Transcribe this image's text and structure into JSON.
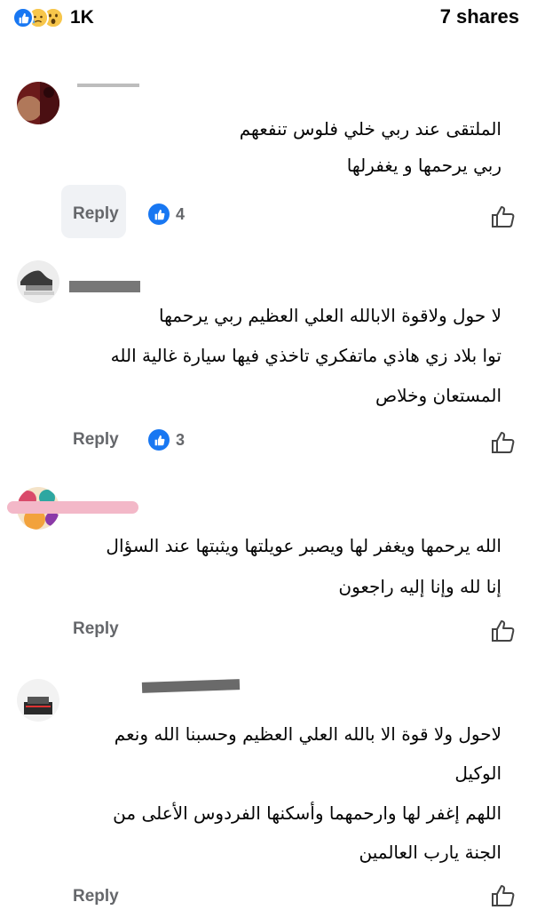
{
  "reactions_bar": {
    "icons": [
      "like-icon",
      "sad-icon",
      "wow-icon"
    ],
    "count": "1K",
    "shares": "7 shares"
  },
  "colors": {
    "like_blue": "#1877f2",
    "reply_gray": "#65676b",
    "text": "#050505"
  },
  "comments": [
    {
      "lines": [
        "الملتقى عند ربي خلي فلوس تنفعهم",
        "ربي يرحمها و يغفرلها"
      ],
      "reply_label": "Reply",
      "like_count": "4"
    },
    {
      "lines": [
        "لا حول ولاقوة الابالله العلي العظيم ربي يرحمها",
        "توا بلاد زي هاذي ماتفكري تاخذي فيها سيارة غالية الله",
        "المستعان وخلاص"
      ],
      "reply_label": "Reply",
      "like_count": "3"
    },
    {
      "lines": [
        "الله يرحمها ويغفر لها ويصبر عويلتها ويثبتها عند السؤال",
        "إنا لله وإنا إليه راجعون"
      ],
      "reply_label": "Reply"
    },
    {
      "lines": [
        "لاحول ولا قوة الا بالله العلي العظيم وحسبنا الله ونعم",
        "الوكيل",
        "اللهم إغفر لها وارحمهما وأسكنها الفردوس الأعلى من",
        "الجنة يارب العالمين"
      ],
      "reply_label": "Reply"
    }
  ]
}
